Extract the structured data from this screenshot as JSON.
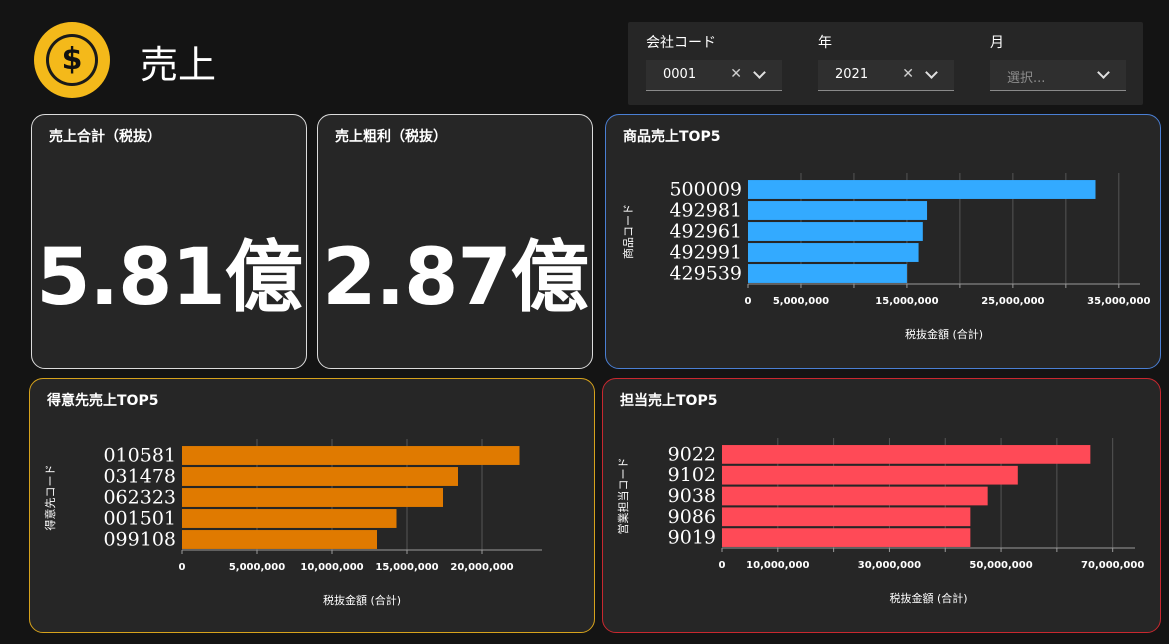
{
  "header": {
    "title": "売上",
    "icon": "dollar-coin-icon",
    "icon_glyph": "$"
  },
  "filters": {
    "company": {
      "label": "会社コード",
      "value": "0001"
    },
    "year": {
      "label": "年",
      "value": "2021"
    },
    "month": {
      "label": "月",
      "placeholder": "選択..."
    }
  },
  "kpis": {
    "sales": {
      "title": "売上合計（税抜）",
      "value": "5.81億"
    },
    "profit": {
      "title": "売上粗利（税抜）",
      "value": "2.87億"
    }
  },
  "colors": {
    "products": "#33aaff",
    "customers": "#e07a00",
    "staff": "#ff4a57",
    "products_border": "#4a7fd4",
    "customers_border": "#d6a21c",
    "staff_border": "#c8282f",
    "icon": "#f4b91a"
  },
  "chart_data": [
    {
      "type": "bar",
      "orientation": "horizontal",
      "title": "商品売上TOP5",
      "ylabel": "商品コード",
      "xlabel": "税抜金額 (合計)",
      "categories": [
        "500009",
        "492981",
        "492961",
        "492991",
        "429539"
      ],
      "values": [
        32800000,
        16900000,
        16500000,
        16100000,
        15000000
      ],
      "xlim": [
        0,
        37000000
      ],
      "ticks": [
        0,
        5000000,
        15000000,
        25000000,
        35000000
      ],
      "tick_labels": [
        "0",
        "5,000,000",
        "15,000,000",
        "25,000,000",
        "35,000,000"
      ],
      "minor_ticks": [
        10000000,
        20000000,
        30000000
      ],
      "grid": true
    },
    {
      "type": "bar",
      "orientation": "horizontal",
      "title": "得意先売上TOP5",
      "ylabel": "得意先コード",
      "xlabel": "税抜金額 (合計)",
      "categories": [
        "010581",
        "031478",
        "062323",
        "001501",
        "099108"
      ],
      "values": [
        22500000,
        18400000,
        17400000,
        14300000,
        13000000
      ],
      "xlim": [
        0,
        24000000
      ],
      "ticks": [
        0,
        5000000,
        10000000,
        15000000,
        20000000
      ],
      "tick_labels": [
        "0",
        "5,000,000",
        "10,000,000",
        "15,000,000",
        "20,000,000"
      ],
      "minor_ticks": [],
      "grid": true
    },
    {
      "type": "bar",
      "orientation": "horizontal",
      "title": "担当売上TOP5",
      "ylabel": "営業担当コード",
      "xlabel": "税抜金額 (合計)",
      "categories": [
        "9022",
        "9102",
        "9038",
        "9086",
        "9019"
      ],
      "values": [
        66000000,
        53000000,
        47600000,
        44500000,
        44500000
      ],
      "xlim": [
        0,
        74000000
      ],
      "ticks": [
        0,
        10000000,
        30000000,
        50000000,
        70000000
      ],
      "tick_labels": [
        "0",
        "10,000,000",
        "30,000,000",
        "50,000,000",
        "70,000,000"
      ],
      "minor_ticks": [
        20000000,
        40000000,
        60000000
      ],
      "grid": true
    }
  ]
}
